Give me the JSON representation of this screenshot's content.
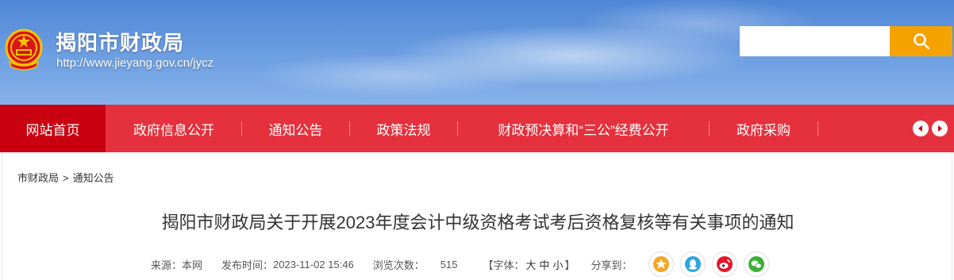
{
  "header": {
    "site_title": "揭阳市财政局",
    "site_url": "http://www.jieyang.gov.cn/jycz",
    "search": {
      "value": "",
      "placeholder": ""
    }
  },
  "nav": {
    "items": [
      {
        "label": "网站首页",
        "active": true
      },
      {
        "label": "政府信息公开"
      },
      {
        "label": "通知公告"
      },
      {
        "label": "政策法规"
      },
      {
        "label": "财政预决算和“三公”经费公开"
      },
      {
        "label": "政府采购"
      }
    ]
  },
  "breadcrumb": {
    "items": [
      "市财政局",
      "通知公告"
    ],
    "separator": ">"
  },
  "article": {
    "title": "揭阳市财政局关于开展2023年度会计中级资格考试考后资格复核等有关事项的通知",
    "meta": {
      "source_label": "来源：",
      "source_value": "本网",
      "time_label": "发布时间：",
      "time_value": "2023-11-02 15:46",
      "views_label": "浏览次数：",
      "views_value": "515",
      "font_open": "【字体：",
      "font_large": "大",
      "font_medium": "中",
      "font_small": "小",
      "font_close": "】",
      "share_label": "分享到："
    }
  },
  "share_icons": [
    "star-icon",
    "qq-icon",
    "weibo-icon",
    "wechat-icon"
  ],
  "colors": {
    "nav_bg": "#e5313d",
    "nav_active": "#c8000f",
    "search_button": "#f6a200",
    "share_star": "#f5a623",
    "share_qq": "#2ea7e0",
    "share_weibo": "#e6162d",
    "share_wechat": "#3cb035"
  }
}
